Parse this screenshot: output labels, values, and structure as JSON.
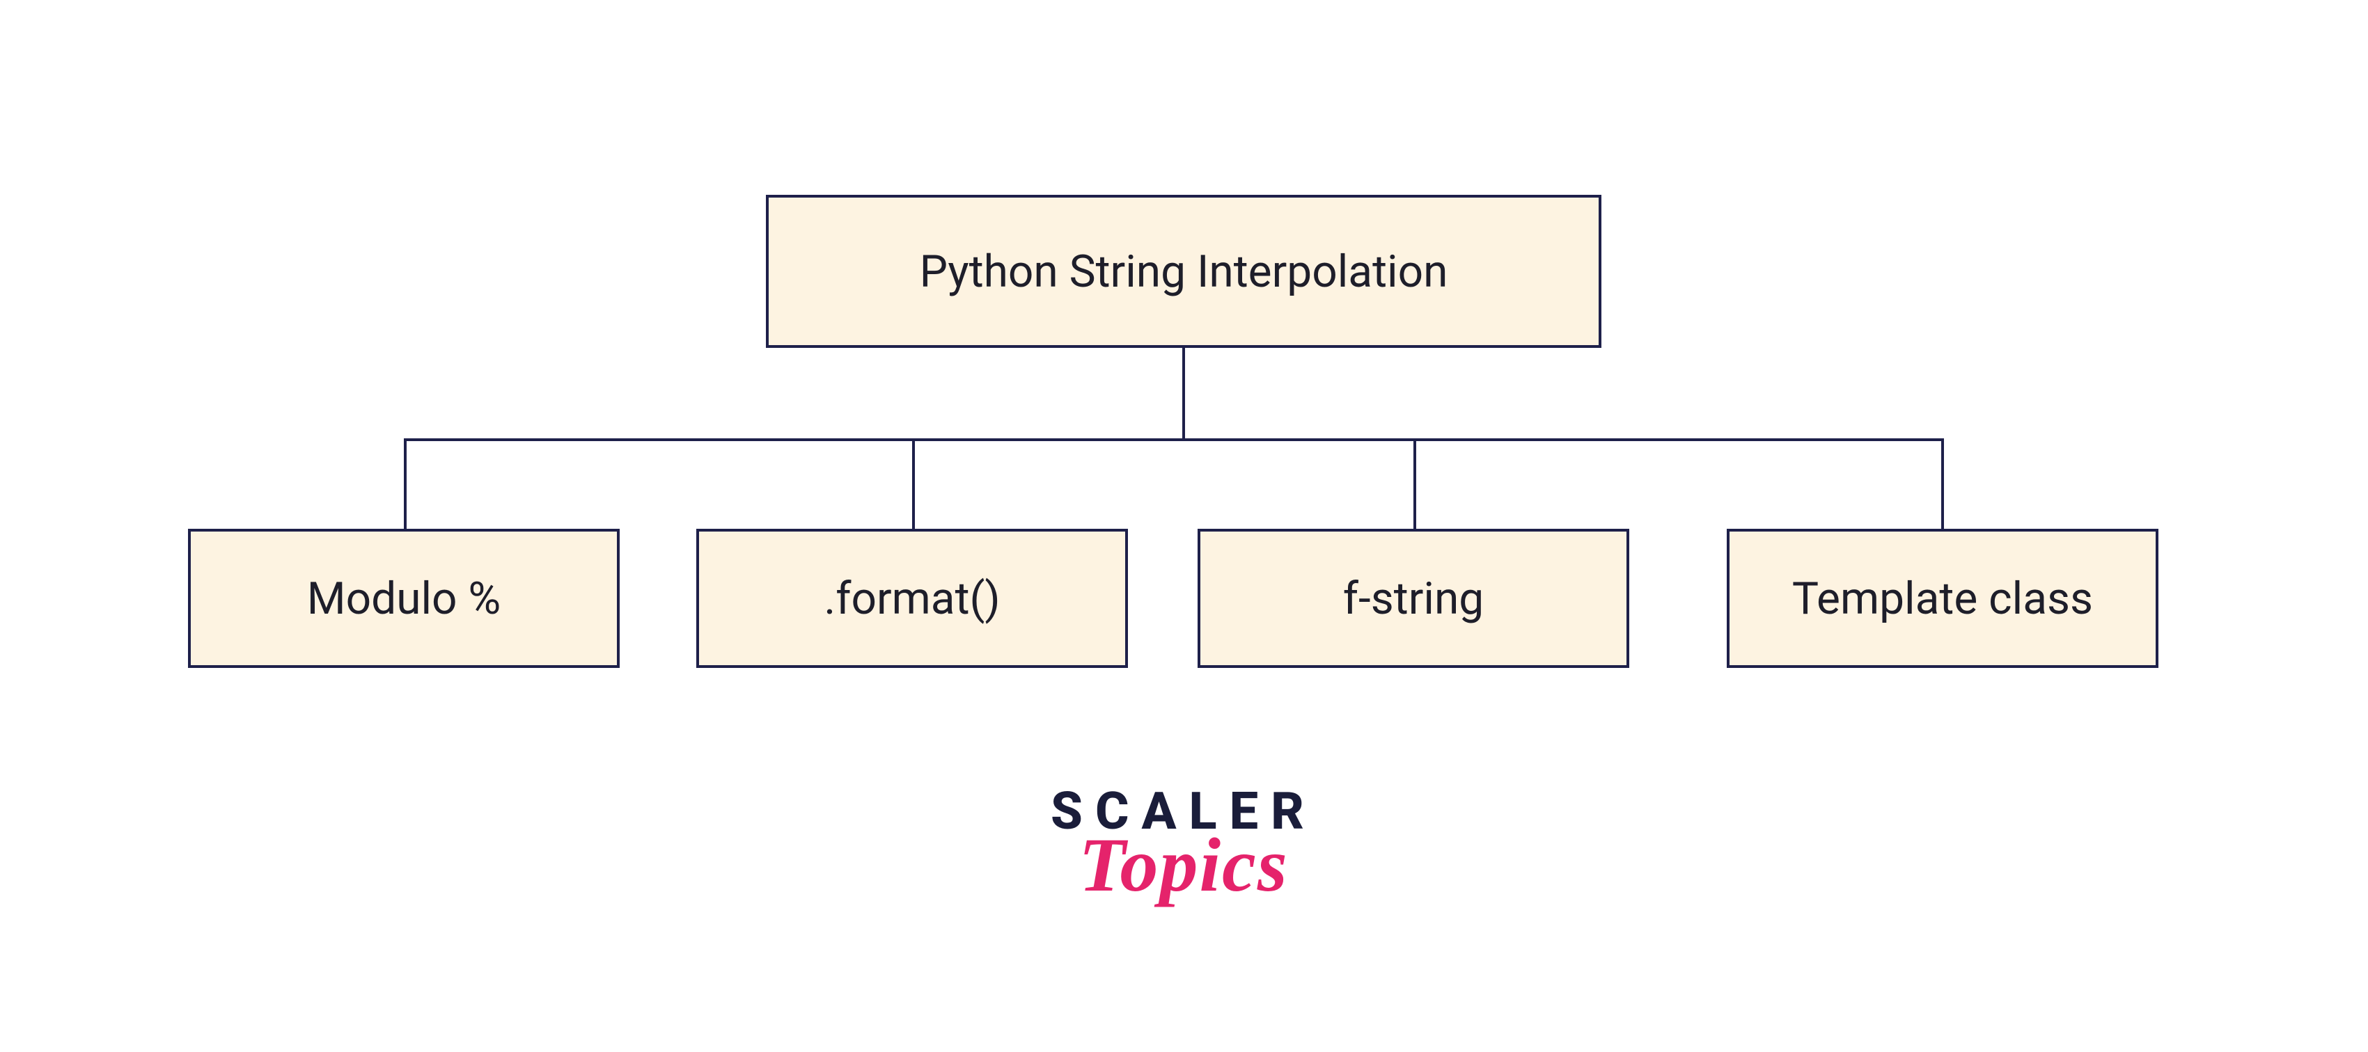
{
  "diagram": {
    "root": {
      "label": "Python String Interpolation"
    },
    "children": [
      {
        "label": "Modulo %"
      },
      {
        "label": ".format()"
      },
      {
        "label": "f-string"
      },
      {
        "label": "Template class"
      }
    ]
  },
  "logo": {
    "line1": "SCALER",
    "line2": "Topics"
  },
  "colors": {
    "node_fill": "#fdf3e1",
    "node_border": "#1e204a",
    "logo_primary": "#1a1d3a",
    "logo_accent": "#e5236b"
  }
}
